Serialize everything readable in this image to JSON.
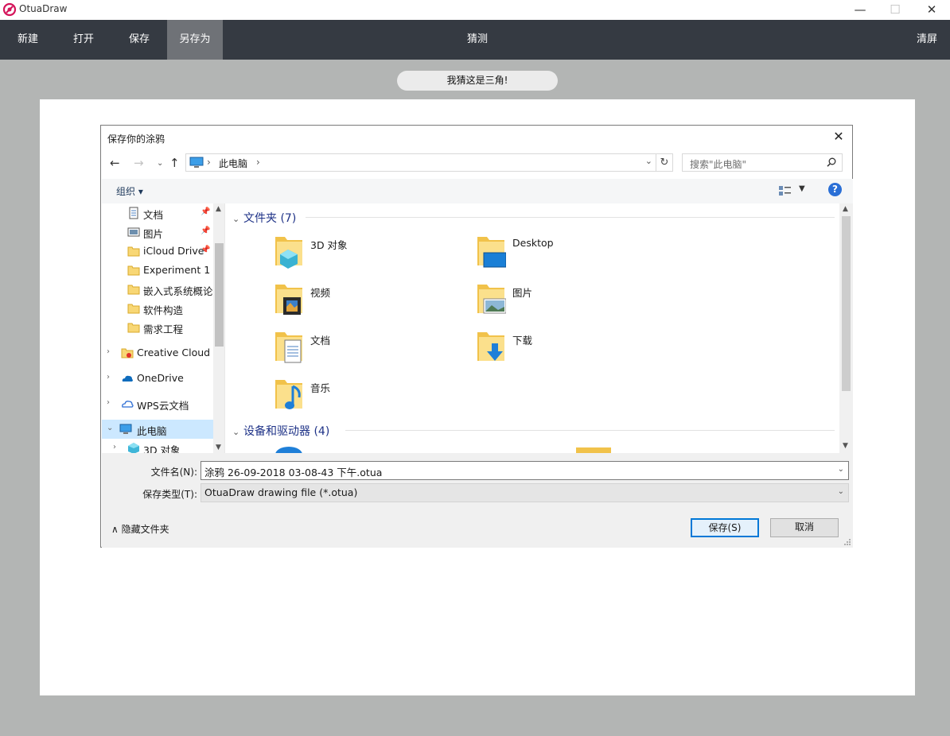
{
  "app": {
    "title": "OtuaDraw"
  },
  "window_controls": {
    "minimize": "—",
    "maximize": "☐",
    "close": "✕"
  },
  "menu": {
    "new": "新建",
    "open": "打开",
    "save": "保存",
    "save_as": "另存为",
    "guess": "猜测",
    "clear": "清屏"
  },
  "guess_result": "我猜这是三角!",
  "dialog": {
    "title": "保存你的涂鸦",
    "close": "✕",
    "address": {
      "location": "此电脑"
    },
    "search_placeholder": "搜索\"此电脑\"",
    "organize": "组织 ▾",
    "help": "?",
    "nav_items": [
      {
        "label": "文档",
        "icon": "document-icon",
        "pinned": true
      },
      {
        "label": "图片",
        "icon": "pictures-icon",
        "pinned": true
      },
      {
        "label": "iCloud Drive",
        "icon": "folder-icon",
        "pinned": true
      },
      {
        "label": "Experiment 1",
        "icon": "folder-icon"
      },
      {
        "label": "嵌入式系统概论",
        "icon": "folder-icon"
      },
      {
        "label": "软件构造",
        "icon": "folder-icon"
      },
      {
        "label": "需求工程",
        "icon": "folder-icon"
      },
      {
        "label": "Creative Cloud F",
        "icon": "creative-cloud-icon",
        "expandable": true
      },
      {
        "label": "OneDrive",
        "icon": "onedrive-icon",
        "expandable": true
      },
      {
        "label": "WPS云文档",
        "icon": "wps-cloud-icon",
        "expandable": true
      },
      {
        "label": "此电脑",
        "icon": "this-pc-icon",
        "expanded": true,
        "selected": true
      },
      {
        "label": "3D 对象",
        "icon": "3d-objects-icon",
        "expandable": true
      }
    ],
    "groups": [
      {
        "title": "文件夹 (7)"
      },
      {
        "title": "设备和驱动器 (4)"
      }
    ],
    "folders": [
      {
        "label": "3D 对象",
        "icon": "3d-objects-folder-icon"
      },
      {
        "label": "Desktop",
        "icon": "desktop-folder-icon"
      },
      {
        "label": "视频",
        "icon": "videos-folder-icon"
      },
      {
        "label": "图片",
        "icon": "pictures-folder-icon"
      },
      {
        "label": "文档",
        "icon": "documents-folder-icon"
      },
      {
        "label": "下载",
        "icon": "downloads-folder-icon"
      },
      {
        "label": "音乐",
        "icon": "music-folder-icon"
      }
    ],
    "filename_label": "文件名(N):",
    "filename_value": "涂鸦 26-09-2018 03-08-43 下午.otua",
    "filetype_label": "保存类型(T):",
    "filetype_value": "OtuaDraw drawing file (*.otua)",
    "hide_folders": "隐藏文件夹",
    "save_button": "保存(S)",
    "cancel_button": "取消"
  },
  "colors": {
    "menubar": "#353a42",
    "menu_active": "#6f7277",
    "backdrop": "#b3b5b4",
    "selection": "#cce8ff",
    "group_header": "#1e3287",
    "accent": "#0078d7"
  }
}
